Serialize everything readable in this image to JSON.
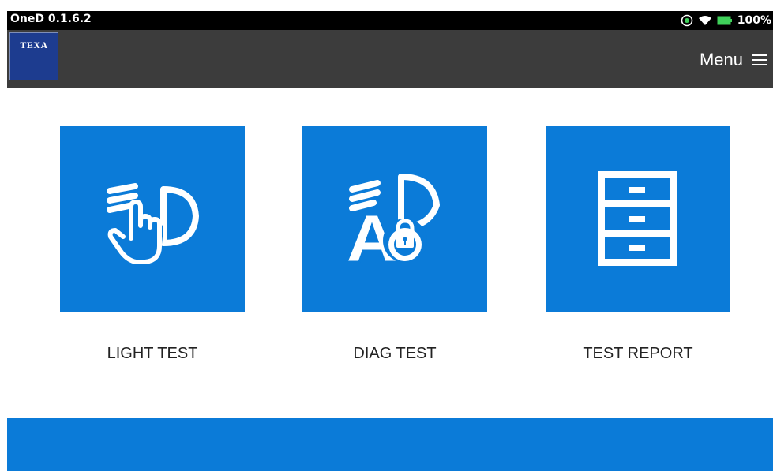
{
  "statusbar": {
    "app_version": "OneD 0.1.6.2",
    "battery": "100%",
    "icons": [
      "record-icon",
      "wifi-icon",
      "battery-icon"
    ]
  },
  "appbar": {
    "logo_text": "TEXA",
    "menu_label": "Menu",
    "menu_icon": "hamburger-icon"
  },
  "tiles": [
    {
      "label": "LIGHT TEST",
      "icon": "headlight-hand-icon"
    },
    {
      "label": "DIAG TEST",
      "icon": "headlight-lock-icon"
    },
    {
      "label": "TEST REPORT",
      "icon": "cabinet-icon"
    }
  ],
  "colors": {
    "accent": "#0b7bd8",
    "appbar": "#3c3c3c",
    "statusbar": "#000000",
    "battery": "#3fd05a"
  }
}
